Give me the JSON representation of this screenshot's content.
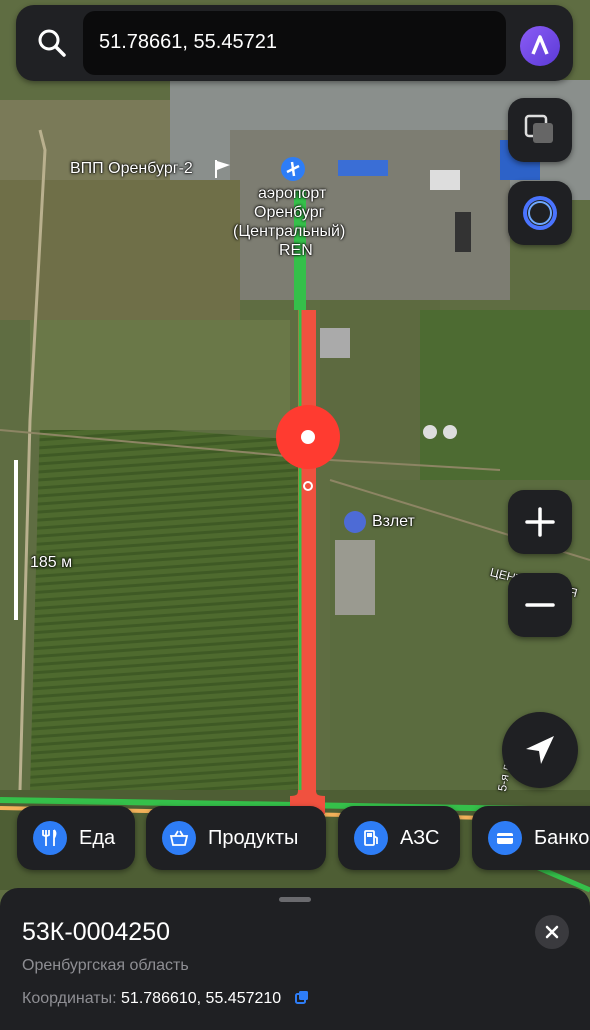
{
  "search": {
    "query": "51.78661, 55.45721"
  },
  "map": {
    "labels": {
      "runway": "ВПП Оренбург-2",
      "airport": [
        "аэропорт",
        "Оренбург",
        "(Центральный)",
        "REN"
      ],
      "hotel": "Взлет",
      "scale": "185 м",
      "street1": "ЦЕНТРАЛЬНАЯ",
      "street2": "5-я линия"
    },
    "colors": {
      "route": "#f0513f",
      "pin": "#ff3b30",
      "accent": "#2e7df6"
    }
  },
  "controls": {
    "layers": "layers-icon",
    "alice": "alice-icon",
    "zoom_in": "plus-icon",
    "zoom_out": "minus-icon",
    "locate": "navigation-arrow-icon"
  },
  "categories": [
    {
      "label": "Еда",
      "icon": "fork-knife-icon"
    },
    {
      "label": "Продукты",
      "icon": "basket-icon"
    },
    {
      "label": "АЗС",
      "icon": "fuel-icon"
    },
    {
      "label": "Банко",
      "icon": "bank-card-icon"
    }
  ],
  "place": {
    "title": "53К-0004250",
    "region": "Оренбургская область",
    "coords_label": "Координаты:",
    "coords_value": "51.786610, 55.457210"
  }
}
